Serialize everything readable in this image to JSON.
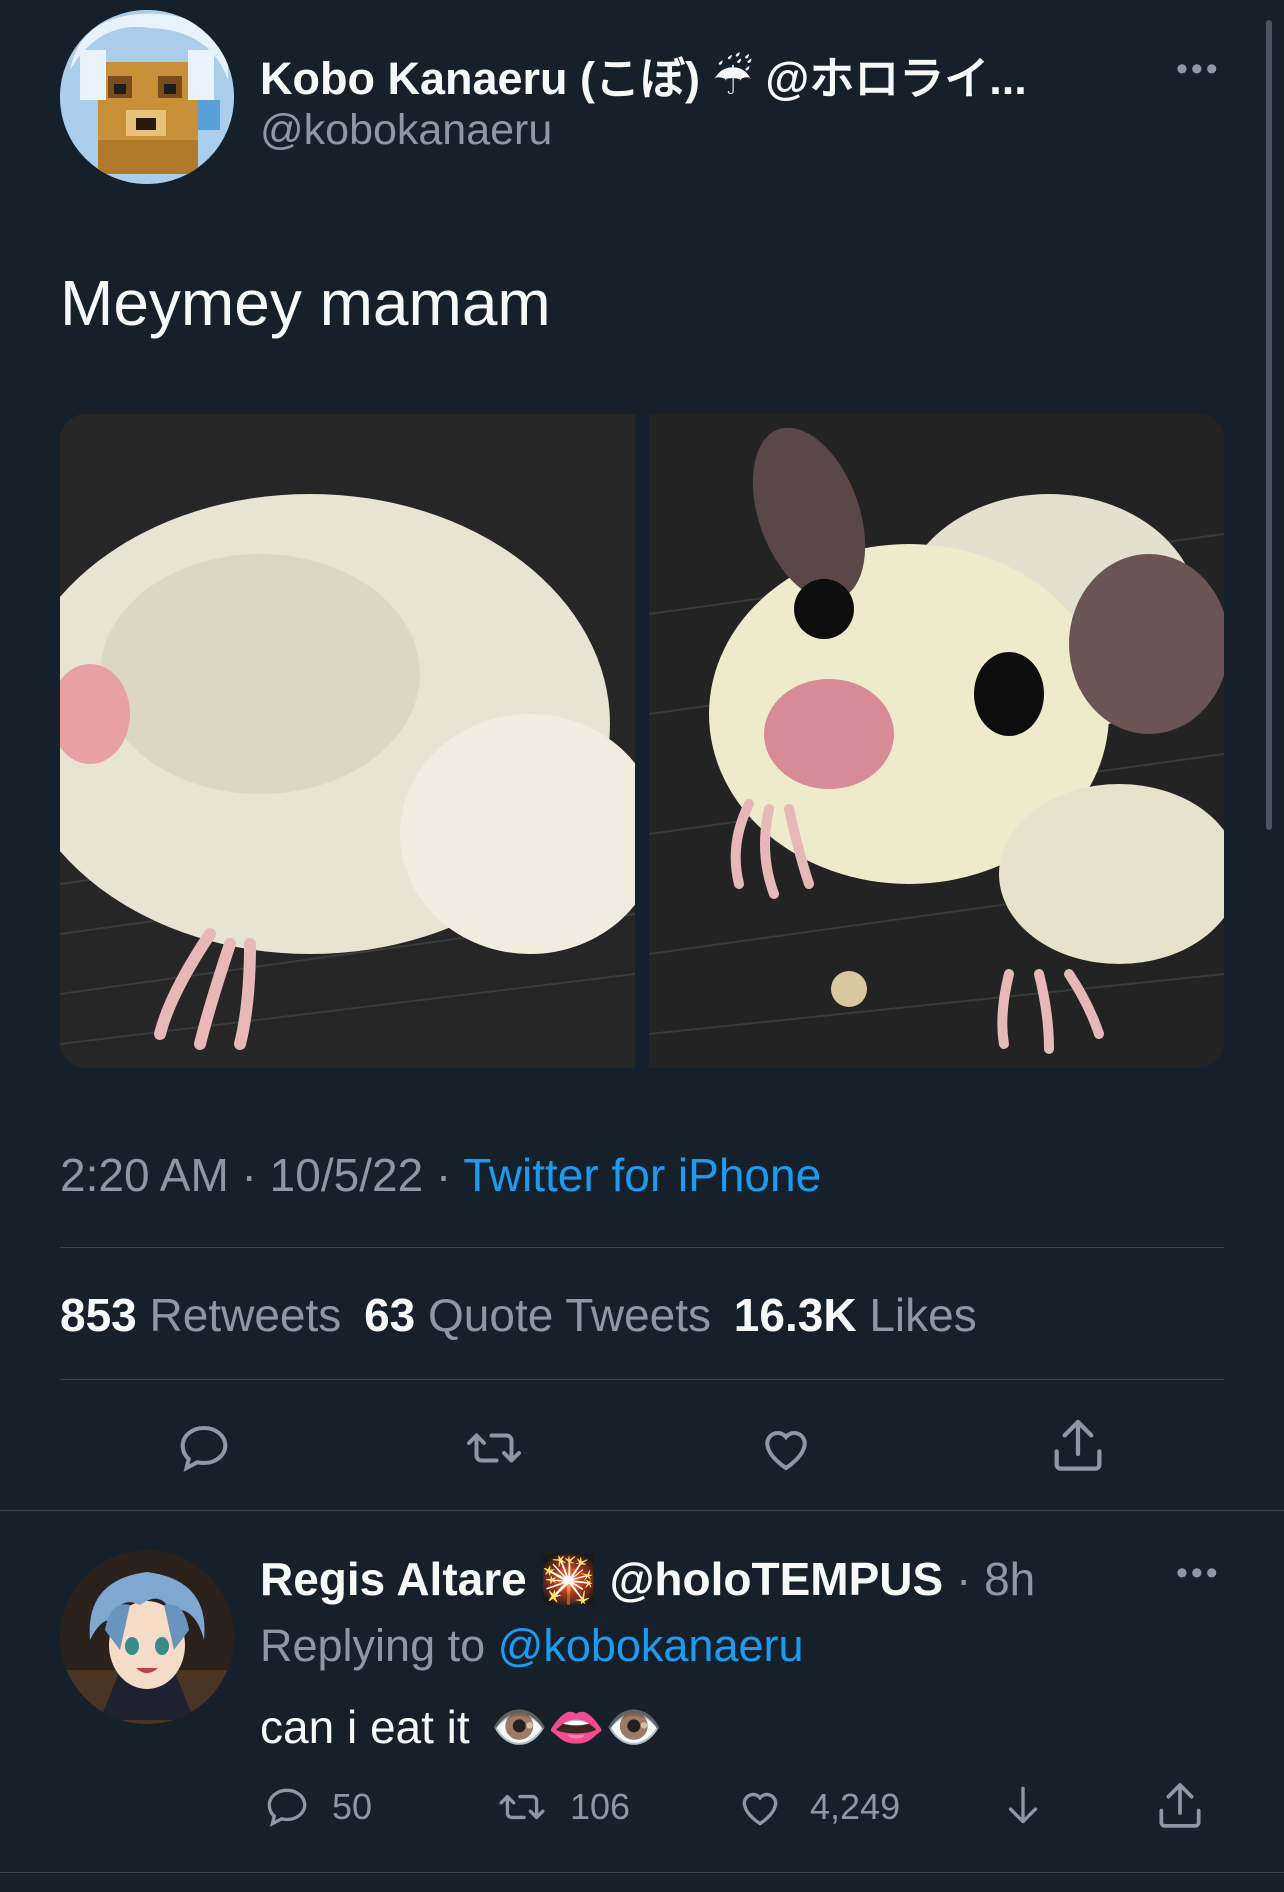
{
  "tweet": {
    "author": {
      "display_name": "Kobo Kanaeru (こぼ)",
      "name_emoji": "☔",
      "name_suffix": "@ホロライ...",
      "handle": "@kobokanaeru",
      "avatar_icon": "kobo-pixel-avatar"
    },
    "text": "Meymey mamam",
    "media": [
      {
        "alt": "sugar-glider-photo-1"
      },
      {
        "alt": "sugar-glider-photo-2"
      }
    ],
    "time": "2:20 AM",
    "sep1": " · ",
    "date": "10/5/22",
    "sep2": " · ",
    "source": "Twitter for iPhone",
    "stats": {
      "retweets_count": "853",
      "retweets_label": "Retweets",
      "quotes_count": "63",
      "quotes_label": "Quote Tweets",
      "likes_count": "16.3K",
      "likes_label": "Likes"
    },
    "more_label": "•••"
  },
  "reply": {
    "author": {
      "display_name": "Regis Altare",
      "name_emoji": "🎇",
      "handle": "@holoTEMPUS",
      "avatar_icon": "regis-anime-avatar"
    },
    "age_sep": " · ",
    "age": "8h",
    "replying_to_label": "Replying to ",
    "replying_to_handle": "@kobokanaeru",
    "text": "can i eat it",
    "text_emoji": "👁️👄👁️",
    "counts": {
      "replies": "50",
      "retweets": "106",
      "likes": "4,249"
    },
    "more_label": "•••"
  },
  "colors": {
    "background": "#15202b",
    "text": "#f7f9f9",
    "muted": "#8b98a5",
    "link": "#1d9bf0",
    "divider": "#38444d"
  }
}
